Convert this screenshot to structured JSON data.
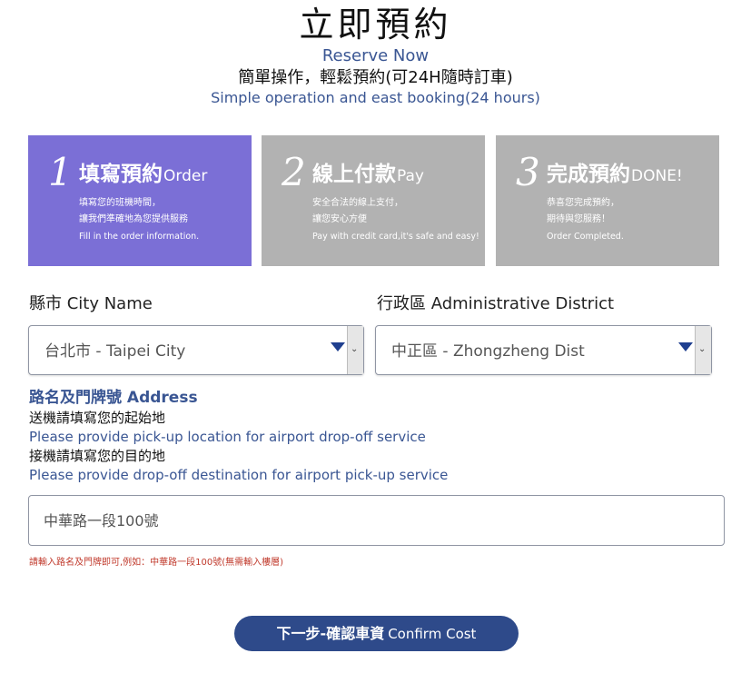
{
  "header": {
    "title": "立即預約",
    "subtitle_en": "Reserve Now",
    "subtitle_zh": "簡單操作，輕鬆預約(可24H隨時訂車)",
    "subtitle_desc": "Simple operation and east booking(24 hours)"
  },
  "steps": [
    {
      "number": "1",
      "title_zh": "填寫預約",
      "title_en": "Order",
      "line1": "填寫您的班機時間，",
      "line2": "讓我們準確地為您提供服務",
      "line3": "Fill in the order information.",
      "active": true
    },
    {
      "number": "2",
      "title_zh": "線上付款",
      "title_en": "Pay",
      "line1": "安全合法的線上支付，",
      "line2": "讓您安心方便",
      "line3": "Pay with credit card,it's safe and easy!",
      "active": false
    },
    {
      "number": "3",
      "title_zh": "完成預約",
      "title_en": "DONE!",
      "line1": "恭喜您完成預約，",
      "line2": "期待與您服務！",
      "line3": "Order Completed.",
      "active": false
    }
  ],
  "form": {
    "city_label": "縣市 City Name",
    "city_value": "台北市 - Taipei City",
    "district_label": "行政區 Administrative District",
    "district_value": "中正區 - Zhongzheng Dist",
    "address_title": "路名及門牌號 Address",
    "dropoff_zh": "送機請填寫您的起始地",
    "dropoff_en": "Please provide pick-up location for airport drop-off service",
    "pickup_zh": "接機請填寫您的目的地",
    "pickup_en": "Please provide drop-off destination for airport pick-up service",
    "address_placeholder": "中華路一段100號",
    "hint": "請輸入路名及門牌即可,例如：中華路一段100號(無需輸入樓層)",
    "scroll_glyph": "⌄"
  },
  "confirm": {
    "label_zh": "下一步-確認車資",
    "label_en": "Confirm Cost"
  },
  "colors": {
    "accent": "#3a5693",
    "active_step": "#7b6fd6",
    "inactive_step": "#b2b2b2",
    "button": "#2e4a8a",
    "hint": "#c0392b"
  }
}
